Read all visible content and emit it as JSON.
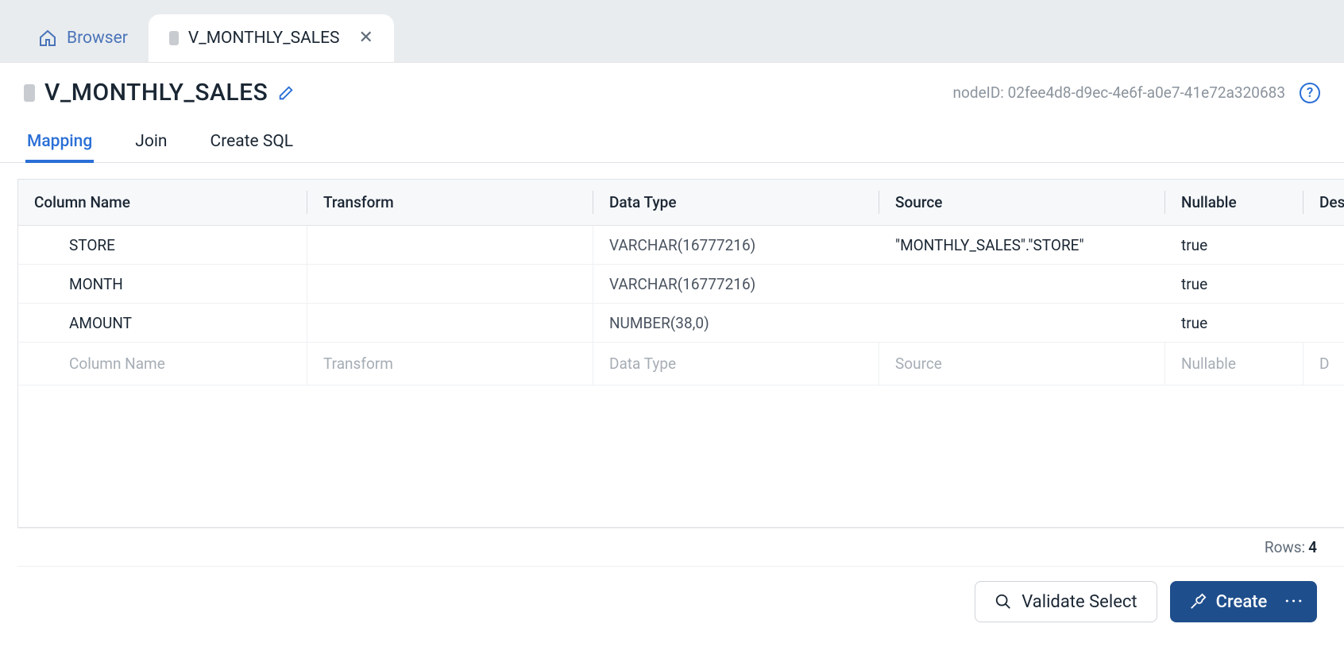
{
  "tabs": {
    "browser_label": "Browser",
    "active_label": "V_MONTHLY_SALES"
  },
  "header": {
    "title": "V_MONTHLY_SALES",
    "node_id_label": "nodeID: 02fee4d8-d9ec-4e6f-a0e7-41e72a320683"
  },
  "subtabs": {
    "mapping": "Mapping",
    "join": "Join",
    "create_sql": "Create SQL"
  },
  "grid": {
    "headers": {
      "column_name": "Column Name",
      "transform": "Transform",
      "data_type": "Data Type",
      "source": "Source",
      "nullable": "Nullable",
      "description": "Des"
    },
    "rows": [
      {
        "column_name": "STORE",
        "transform": "",
        "data_type": "VARCHAR(16777216)",
        "source": "\"MONTHLY_SALES\".\"STORE\"",
        "nullable": "true"
      },
      {
        "column_name": "MONTH",
        "transform": "",
        "data_type": "VARCHAR(16777216)",
        "source": "",
        "nullable": "true"
      },
      {
        "column_name": "AMOUNT",
        "transform": "",
        "data_type": "NUMBER(38,0)",
        "source": "",
        "nullable": "true"
      }
    ],
    "placeholder": {
      "column_name": "Column Name",
      "transform": "Transform",
      "data_type": "Data Type",
      "source": "Source",
      "nullable": "Nullable",
      "description": "D"
    }
  },
  "footer": {
    "rows_label": "Rows:",
    "rows_count": "4"
  },
  "actions": {
    "validate_label": "Validate Select",
    "create_label": "Create",
    "more_dots": "···"
  }
}
